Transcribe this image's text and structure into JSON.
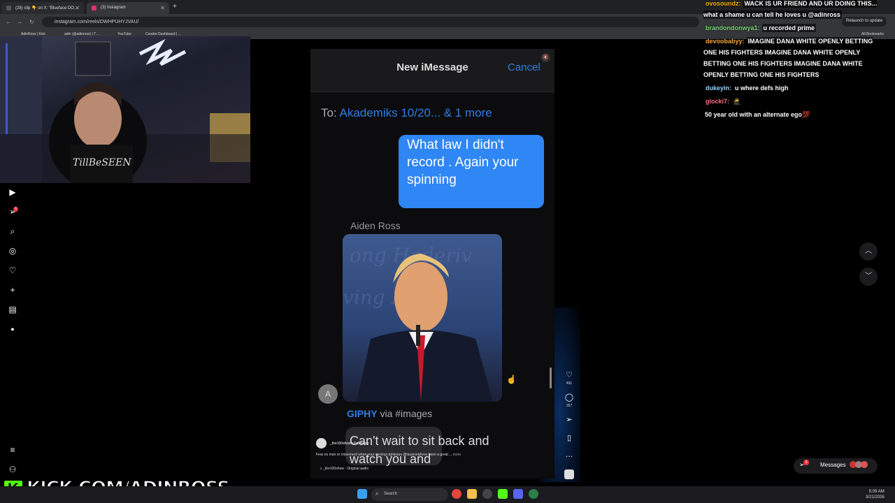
{
  "browser": {
    "tabs": [
      {
        "title": "(28) clip 👇 on X: \"Blueface DO…"
      },
      {
        "title": "(3) Instagram"
      }
    ],
    "url": "instagram.com/reels/DWHPUHYJVAU/",
    "relaunch_label": "Relaunch to update",
    "bookmarks": [
      "AdinRoss | Kick",
      "adin (@adinross) | T…",
      "YouTube",
      "Creator Dashboard | …"
    ],
    "all_bookmarks": "All Bookmarks"
  },
  "sidebar": {
    "icons": [
      "reels-icon",
      "send-icon",
      "search-icon",
      "explore-icon",
      "heart-icon",
      "create-icon",
      "dashboard-icon",
      "profile-icon"
    ],
    "notification_count": "6"
  },
  "reel": {
    "header_title": "New iMessage",
    "cancel": "Cancel",
    "to_prefix": "To:",
    "to_recipients": "Akademiks 10/20... & 1 more",
    "sent_message": "What law I didn't record . Again your spinning",
    "sender_name": "Aiden Ross",
    "avatar_letter": "A",
    "giphy_label": "GIPHY",
    "giphy_suffix": "via #images",
    "partial_message": "Can't wait to sit back and watch you and",
    "author": "_the100show",
    "following": "• Following",
    "caption": "Fear no man or movement when your moving righteous @tazarvelylivve been a great ...",
    "caption_more": "more",
    "audio": "_the100show · Original audio"
  },
  "actions": {
    "likes": "491",
    "comments": "357"
  },
  "chat": [
    {
      "user": "ovosoundz:",
      "color": "#f0b400",
      "message": "WACK IS UR FRIEND AND UR DOING THIS... what a shame u can tell he loves u @adinross"
    },
    {
      "user": "brandondonwya1:",
      "color": "#7cd67c",
      "message": "u recorded prime"
    },
    {
      "user": "devoobabyy:",
      "color": "#f5a742",
      "message": "IMAGINE DANA WHITE OPENLY BETTING ONE HIS FIGHTERS IMAGINE DANA WHITE OPENLY BETTING ONE HIS FIGHTERS IMAGINE DANA WHITE OPENLY BETTING ONE HIS FIGHTERS"
    },
    {
      "user": "dukeyin:",
      "color": "#8fd3ff",
      "message": "u where defs high"
    },
    {
      "user": "glocki7:",
      "color": "#ff6b81",
      "message": "🥷"
    },
    {
      "user": "",
      "color": "#ffffff",
      "message": "50 year old with an alternate ego💯"
    }
  ],
  "messages_pill": "Messages",
  "messages_badge": "3",
  "kick_banner": "KICK.COM/ADINROSS",
  "taskbar": {
    "search_placeholder": "Search",
    "time": "5:09 AM",
    "date": "3/21/2026"
  },
  "colors": {
    "imessage_blue": "#2f86f5",
    "link_blue": "#2f7de1",
    "kick_green": "#53fc18"
  }
}
